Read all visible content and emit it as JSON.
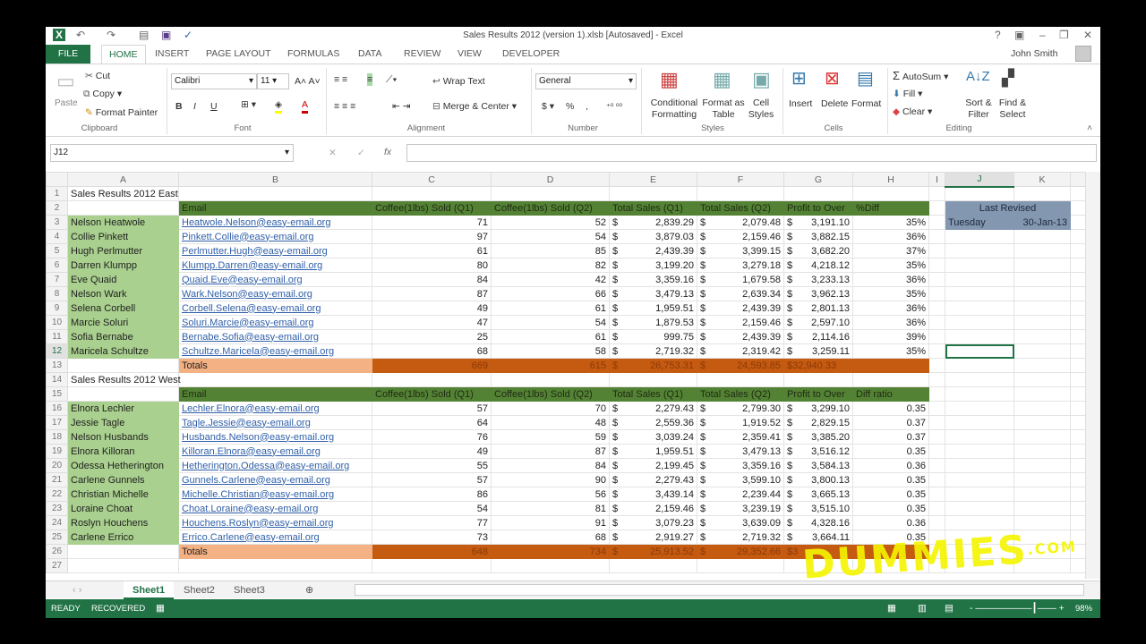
{
  "window": {
    "title": "Sales Results 2012 (version 1).xlsb [Autosaved] - Excel",
    "user": "John Smith",
    "help": "?",
    "minimize": "–",
    "restore": "❐",
    "close": "✕"
  },
  "tabs": [
    "FILE",
    "HOME",
    "INSERT",
    "PAGE LAYOUT",
    "FORMULAS",
    "DATA",
    "REVIEW",
    "VIEW",
    "DEVELOPER"
  ],
  "ribbon": {
    "clipboard": {
      "paste": "Paste",
      "cut": "Cut",
      "copy": "Copy",
      "format_painter": "Format Painter",
      "label": "Clipboard"
    },
    "font": {
      "name": "Calibri",
      "size": "11",
      "bold": "B",
      "italic": "I",
      "underline": "U",
      "label": "Font"
    },
    "alignment": {
      "wrap_text": "Wrap Text",
      "merge_center": "Merge & Center",
      "label": "Alignment"
    },
    "number": {
      "format": "General",
      "currency": "$",
      "percent": "%",
      "comma": ",",
      "label": "Number"
    },
    "styles": {
      "conditional": "Conditional Formatting",
      "format_table": "Format as Table",
      "cell_styles": "Cell Styles",
      "label": "Styles"
    },
    "cells": {
      "insert": "Insert",
      "delete": "Delete",
      "format": "Format",
      "label": "Cells"
    },
    "editing": {
      "autosum": "AutoSum",
      "fill": "Fill",
      "clear": "Clear",
      "sort_filter": "Sort & Filter",
      "find_select": "Find & Select",
      "label": "Editing"
    }
  },
  "formula_bar": {
    "name_box": "J12",
    "cancel": "✕",
    "enter": "✓",
    "fx": "fx",
    "value": ""
  },
  "columns": [
    "A",
    "B",
    "C",
    "D",
    "E",
    "F",
    "G",
    "H",
    "I",
    "J",
    "K"
  ],
  "east": {
    "title": "Sales Results 2012 East",
    "headers": [
      "Email",
      "Coffee(1lbs) Sold (Q1)",
      "Coffee(1lbs) Sold (Q2)",
      "Total Sales (Q1)",
      "Total Sales (Q2)",
      "Profit to Over",
      "%Diff"
    ],
    "rows": [
      [
        "Nelson Heatwole",
        "Heatwole.Nelson@easy-email.org",
        "71",
        "52",
        "2,839.29",
        "2,079.48",
        "3,191.10",
        "35%"
      ],
      [
        "Collie Pinkett",
        "Pinkett.Collie@easy-email.org",
        "97",
        "54",
        "3,879.03",
        "2,159.46",
        "3,882.15",
        "36%"
      ],
      [
        "Hugh Perlmutter",
        "Perlmutter.Hugh@easy-email.org",
        "61",
        "85",
        "2,439.39",
        "3,399.15",
        "3,682.20",
        "37%"
      ],
      [
        "Darren Klumpp",
        "Klumpp.Darren@easy-email.org",
        "80",
        "82",
        "3,199.20",
        "3,279.18",
        "4,218.12",
        "35%"
      ],
      [
        "Eve Quaid",
        "Quaid.Eve@easy-email.org",
        "84",
        "42",
        "3,359.16",
        "1,679.58",
        "3,233.13",
        "36%"
      ],
      [
        "Nelson Wark",
        "Wark.Nelson@easy-email.org",
        "87",
        "66",
        "3,479.13",
        "2,639.34",
        "3,962.13",
        "35%"
      ],
      [
        "Selena Corbell",
        "Corbell.Selena@easy-email.org",
        "49",
        "61",
        "1,959.51",
        "2,439.39",
        "2,801.13",
        "36%"
      ],
      [
        "Marcie Soluri",
        "Soluri.Marcie@easy-email.org",
        "47",
        "54",
        "1,879.53",
        "2,159.46",
        "2,597.10",
        "36%"
      ],
      [
        "Sofia Bernabe",
        "Bernabe.Sofia@easy-email.org",
        "25",
        "61",
        "999.75",
        "2,439.39",
        "2,114.16",
        "39%"
      ],
      [
        "Maricela Schultze",
        "Schultze.Maricela@easy-email.org",
        "68",
        "58",
        "2,719.32",
        "2,319.42",
        "3,259.11",
        "35%"
      ]
    ],
    "totals": {
      "label": "Totals",
      "q1": "669",
      "q2": "615",
      "sales_q1": "26,753.31",
      "sales_q2": "24,593.85",
      "profit": "$32,940.33"
    }
  },
  "west": {
    "title": "Sales Results 2012 West",
    "headers": [
      "Email",
      "Coffee(1lbs) Sold (Q1)",
      "Coffee(1lbs) Sold (Q2)",
      "Total Sales (Q1)",
      "Total Sales (Q2)",
      "Profit to Over",
      "Diff ratio"
    ],
    "rows": [
      [
        "Elnora Lechler",
        "Lechler.Elnora@easy-email.org",
        "57",
        "70",
        "2,279.43",
        "2,799.30",
        "3,299.10",
        "0.35"
      ],
      [
        "Jessie Tagle",
        "Tagle.Jessie@easy-email.org",
        "64",
        "48",
        "2,559.36",
        "1,919.52",
        "2,829.15",
        "0.37"
      ],
      [
        "Nelson Husbands",
        "Husbands.Nelson@easy-email.org",
        "76",
        "59",
        "3,039.24",
        "2,359.41",
        "3,385.20",
        "0.37"
      ],
      [
        "Elnora Killoran",
        "Killoran.Elnora@easy-email.org",
        "49",
        "87",
        "1,959.51",
        "3,479.13",
        "3,516.12",
        "0.35"
      ],
      [
        "Odessa Hetherington",
        "Hetherington.Odessa@easy-email.org",
        "55",
        "84",
        "2,199.45",
        "3,359.16",
        "3,584.13",
        "0.36"
      ],
      [
        "Carlene Gunnels",
        "Gunnels.Carlene@easy-email.org",
        "57",
        "90",
        "2,279.43",
        "3,599.10",
        "3,800.13",
        "0.35"
      ],
      [
        "Christian Michelle",
        "Michelle.Christian@easy-email.org",
        "86",
        "56",
        "3,439.14",
        "2,239.44",
        "3,665.13",
        "0.35"
      ],
      [
        "Loraine Choat",
        "Choat.Loraine@easy-email.org",
        "54",
        "81",
        "2,159.46",
        "3,239.19",
        "3,515.10",
        "0.35"
      ],
      [
        "Roslyn Houchens",
        "Houchens.Roslyn@easy-email.org",
        "77",
        "91",
        "3,079.23",
        "3,639.09",
        "4,328.16",
        "0.36"
      ],
      [
        "Carlene Errico",
        "Errico.Carlene@easy-email.org",
        "73",
        "68",
        "2,919.27",
        "2,719.32",
        "3,664.11",
        "0.35"
      ]
    ],
    "totals": {
      "label": "Totals",
      "q1": "648",
      "q2": "734",
      "sales_q1": "25,913.52",
      "sales_q2": "29,352.66",
      "profit": "$3"
    }
  },
  "last_revised": {
    "label": "Last Revised",
    "day": "Tuesday",
    "date": "30-Jan-13"
  },
  "currency_symbol": "$",
  "sheets": [
    "Sheet1",
    "Sheet2",
    "Sheet3"
  ],
  "status": {
    "ready": "READY",
    "recovered": "RECOVERED",
    "zoom": "98%"
  },
  "watermark": {
    "text": "DUMMIES",
    "suffix": ".COM"
  }
}
